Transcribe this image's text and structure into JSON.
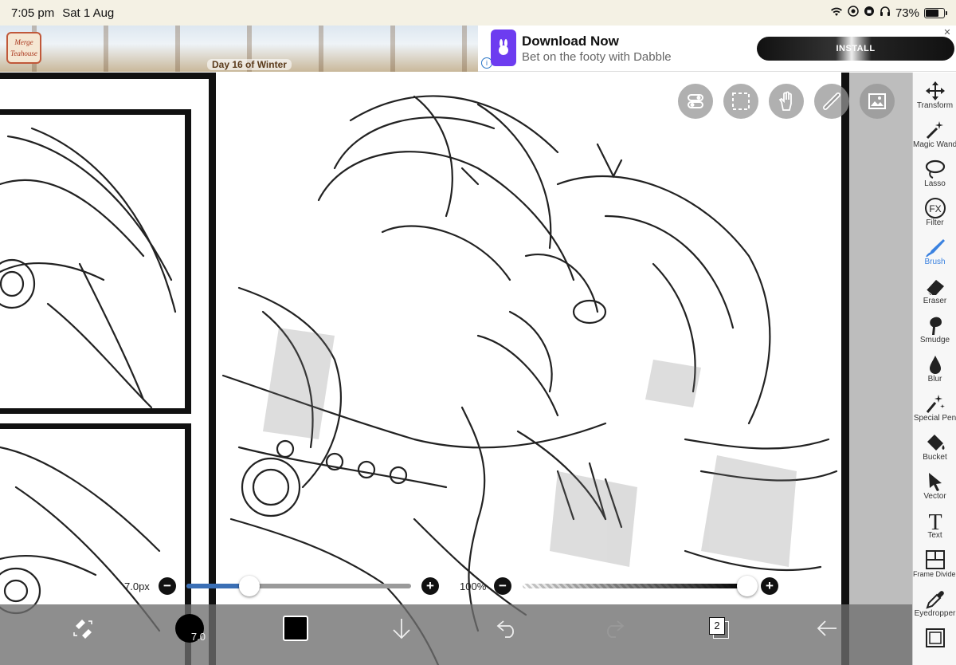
{
  "status_bar": {
    "time": "7:05 pm",
    "date": "Sat 1 Aug",
    "battery": "73%",
    "battery_level": 0.73
  },
  "ad": {
    "game_name": "Merge Teahouse",
    "game_caption": "Day 16 of Winter",
    "title": "Download Now",
    "subtitle": "Bet on the footy with Dabble",
    "install_label": "INSTALL",
    "close_icon": "close-icon"
  },
  "quick_tools": [
    "toggle-icon",
    "selection-icon",
    "hand-icon",
    "ruler-icon",
    "image-icon"
  ],
  "toolbar": {
    "items": [
      {
        "label": "Transform",
        "icon": "move-icon"
      },
      {
        "label": "Magic Wand",
        "icon": "magic-wand-icon"
      },
      {
        "label": "Lasso",
        "icon": "lasso-icon"
      },
      {
        "label": "Filter",
        "icon": "fx-icon",
        "glyph": "FX"
      },
      {
        "label": "Brush",
        "icon": "brush-icon",
        "active": true
      },
      {
        "label": "Eraser",
        "icon": "eraser-icon"
      },
      {
        "label": "Smudge",
        "icon": "smudge-icon"
      },
      {
        "label": "Blur",
        "icon": "blur-drop-icon"
      },
      {
        "label": "Special Pen",
        "icon": "special-pen-icon"
      },
      {
        "label": "Bucket",
        "icon": "bucket-icon"
      },
      {
        "label": "Vector",
        "icon": "vector-cursor-icon"
      },
      {
        "label": "Text",
        "icon": "text-icon",
        "glyph": "T"
      },
      {
        "label": "Frame Divider",
        "icon": "frame-divider-icon"
      },
      {
        "label": "Eyedropper",
        "icon": "eyedropper-icon"
      },
      {
        "label": "",
        "icon": "canvas-icon"
      }
    ]
  },
  "brush_size": {
    "label": "7.0px",
    "value_fraction": 0.28
  },
  "opacity": {
    "label": "100%",
    "value_fraction": 1.0
  },
  "bottom_bar": {
    "brush_badge": "7.0",
    "layer_count": "2",
    "color": "#000000",
    "icons": [
      "swap-tool-icon",
      "brush-size-icon",
      "color-swatch-icon",
      "download-arrow-icon",
      "undo-icon",
      "redo-icon",
      "layers-icon",
      "back-arrow-icon"
    ]
  },
  "colors": {
    "accent": "#3b82e0",
    "ad_purple": "#6d3cf0"
  }
}
